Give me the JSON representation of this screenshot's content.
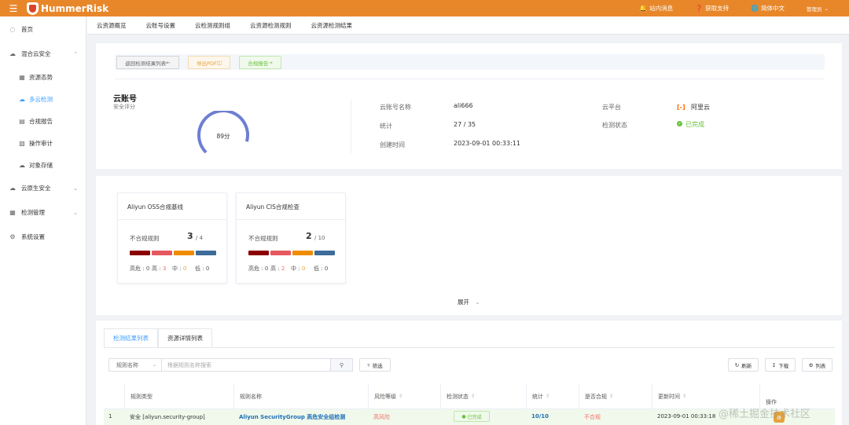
{
  "app": {
    "name": "HummerRisk"
  },
  "topbar": {
    "messages": "站内消息",
    "support": "获取支持",
    "language": "简体中文",
    "user": "管理员"
  },
  "sidebar": {
    "home": "首页",
    "hybrid_cloud": "混合云安全",
    "resource_situation": "资源态势",
    "multi_cloud_check": "多云检测",
    "compliance_report": "合规报告",
    "operation_audit": "操作审计",
    "object_storage": "对象存储",
    "cloud_native": "云原生安全",
    "check_mgmt": "检测管理",
    "system_settings": "系统设置"
  },
  "tabs": [
    "云资源概览",
    "云账号设置",
    "云检测规则组",
    "云资源检测规则",
    "云资源检测结果"
  ],
  "actions": {
    "back": "返回检测结果列表",
    "export_pdf": "导出PDF",
    "compliance": "合规报告"
  },
  "account": {
    "title": "云账号",
    "subtitle": "安全评分",
    "score": 89,
    "score_label": "89分",
    "name_label": "云账号名称",
    "name": "ali666",
    "stats_label": "统计",
    "stats": "27 / 35",
    "created_label": "创建时间",
    "created": "2023-09-01 00:33:11",
    "platform_label": "云平台",
    "platform": "阿里云",
    "status_label": "检测状态",
    "status": "已完成"
  },
  "benchmarks": [
    {
      "title": "Aliyun OSS合规基线",
      "label": "不合规规则",
      "count": "3",
      "total": "/ 4",
      "high_label": "高危 : ",
      "high": "0",
      "mid_high_label": "高 : ",
      "mid_high": "3",
      "mid_label": "中 : ",
      "mid": "0",
      "low_label": "低 : ",
      "low": "0"
    },
    {
      "title": "Aliyun CIS合规检查",
      "label": "不合规规则",
      "count": "2",
      "total": "/ 10",
      "high_label": "高危 : ",
      "high": "0",
      "mid_high_label": "高 : ",
      "mid_high": "2",
      "mid_label": "中 : ",
      "mid": "0",
      "low_label": "低 : ",
      "low": "0"
    }
  ],
  "severity_colors": {
    "critical": "#8b0000",
    "high": "#e6585f",
    "medium": "#f08c00",
    "low": "#3d6b9a"
  },
  "expand": "展开",
  "results": {
    "tab_results": "检测结果列表",
    "tab_resources": "资源详情列表",
    "select": "规则名称",
    "search_placeholder": "根据规则名称搜索",
    "filter": "筛选",
    "refresh": "刷新",
    "download": "下载",
    "columns_btn": "列表",
    "columns": [
      "规则类型",
      "规则名称",
      "风险等级",
      "检测状态",
      "统计",
      "是否合规",
      "更新时间",
      "操作"
    ],
    "row": {
      "index": "1",
      "type": "安全 [aliyun.security-group]",
      "name": "Aliyun SecurityGroup 高危安全组检测",
      "risk": "高风险",
      "status": "已完成",
      "stats": "10/10",
      "compliant": "不合规",
      "updated": "2023-09-01 00:33:18"
    }
  },
  "watermark": "@稀土掘金技术社区"
}
